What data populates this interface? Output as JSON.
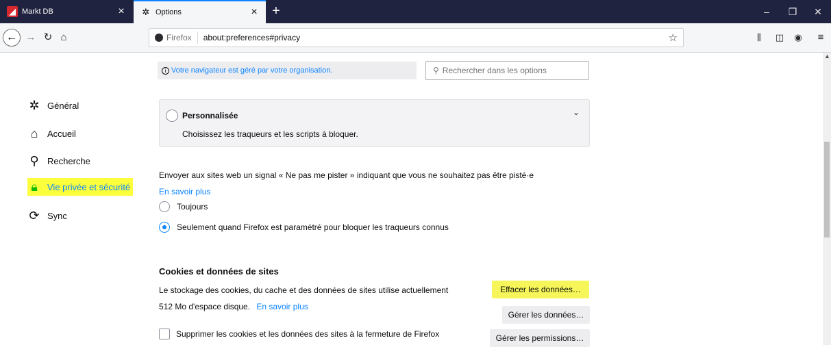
{
  "tabs": [
    {
      "label": "Markt DB",
      "icon": "markt-db-favicon"
    },
    {
      "label": "Options",
      "icon": "gear-icon",
      "active": true
    }
  ],
  "window_controls": {
    "minimize": "–",
    "restore": "❐",
    "close": "✕"
  },
  "navbar": {
    "identity_label": "Firefox",
    "url": "about:preferences#privacy"
  },
  "managed_notice": "Votre navigateur est géré par votre organisation.",
  "search": {
    "placeholder": "Rechercher dans les options"
  },
  "sidebar": {
    "items": [
      {
        "label": "Général",
        "icon": "gear-icon"
      },
      {
        "label": "Accueil",
        "icon": "home-icon"
      },
      {
        "label": "Recherche",
        "icon": "search-icon"
      },
      {
        "label": "Vie privée et sécurité",
        "icon": "lock-icon",
        "selected": true
      },
      {
        "label": "Sync",
        "icon": "sync-icon"
      }
    ]
  },
  "custom_blocking": {
    "title": "Personnalisée",
    "description": "Choisissez les traqueurs et les scripts à bloquer."
  },
  "dnt": {
    "description": "Envoyer aux sites web un signal « Ne pas me pister » indiquant que vous ne souhaitez pas être pisté·e",
    "learn_more": "En savoir plus",
    "options": [
      {
        "label": "Toujours",
        "checked": false
      },
      {
        "label": "Seulement quand Firefox est paramétré pour bloquer les traqueurs connus",
        "checked": true
      }
    ]
  },
  "cookies": {
    "title": "Cookies et données de sites",
    "desc_line1": "Le stockage des cookies, du cache et des données de sites utilise actuellement",
    "desc_line2": "512 Mo d'espace disque.",
    "learn_more": "En savoir plus",
    "clear_button": "Effacer les données…",
    "manage_button": "Gérer les données…",
    "permissions_button": "Gérer les permissions…",
    "delete_on_close": "Supprimer les cookies et les données des sites à la fermeture de Firefox"
  },
  "colors": {
    "accent": "#0a84ff",
    "highlight": "#fbff3c",
    "tabbar": "#202340"
  }
}
